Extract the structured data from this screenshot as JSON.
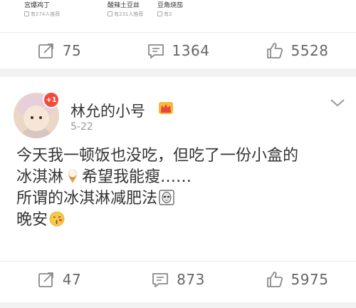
{
  "recipes": [
    {
      "name": "宫爆鸡丁",
      "meta": "有274人推荐"
    },
    {
      "name": "酸辣土豆丝",
      "meta": "有231人推荐"
    },
    {
      "name": "豆角烧茄",
      "meta": "有2"
    }
  ],
  "post1": {
    "repost_count": "75",
    "comment_count": "1364",
    "like_count": "5528"
  },
  "post2": {
    "username": "林允的小号",
    "date": "5-22",
    "badge": "+1",
    "lines": {
      "l1": "今天我一顿饭也没吃，但吃了一份小盒的",
      "l2a": "冰淇淋",
      "l2b": "希望我能瘦……",
      "l3": "所谓的冰淇淋减肥法",
      "l4": "晚安"
    },
    "repost_count": "47",
    "comment_count": "873",
    "like_count": "5975"
  },
  "icons": {
    "repost": "repost-icon",
    "comment": "comment-icon",
    "like": "like-icon",
    "vip": "crown-icon",
    "more": "chevron-down-icon",
    "ice_cream": "ice-cream-emoji",
    "alien": "alien-emoji",
    "kiss": "kiss-emoji"
  },
  "colors": {
    "badge": "#f24b3c",
    "background": "#f2f2f2",
    "text": "#333333",
    "muted": "#999999"
  }
}
